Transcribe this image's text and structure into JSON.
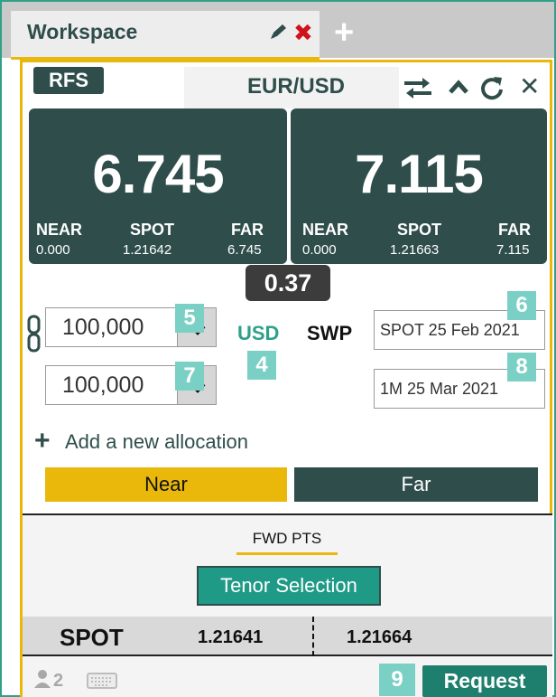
{
  "workspace": {
    "title": "Workspace",
    "add_tab_label": "+"
  },
  "ticket": {
    "product": "RFS",
    "pair": "EUR/USD",
    "icons": [
      "swap-icon",
      "collapse-up-icon",
      "refresh-icon",
      "close-icon"
    ]
  },
  "tiles": {
    "near": {
      "rate": "6.745",
      "labels": {
        "near": "NEAR",
        "spot": "SPOT",
        "far": "FAR"
      },
      "values": {
        "near": "0.000",
        "spot": "1.21642",
        "far": "6.745"
      }
    },
    "far": {
      "rate": "7.115",
      "labels": {
        "near": "NEAR",
        "spot": "SPOT",
        "far": "FAR"
      },
      "values": {
        "near": "0.000",
        "spot": "1.21663",
        "far": "7.115"
      }
    }
  },
  "spread": "0.37",
  "amounts": {
    "near": "100,000",
    "far": "100,000"
  },
  "currency": "USD",
  "side": "SWP",
  "dates": {
    "near": "SPOT 25 Feb 2021",
    "far": "1M 25 Mar 2021"
  },
  "badges": {
    "b4": "4",
    "b5": "5",
    "b6": "6",
    "b7": "7",
    "b8": "8",
    "b9": "9"
  },
  "add_allocation": "Add a new allocation",
  "legs": {
    "near": "Near",
    "far": "Far"
  },
  "fwd_pts": "FWD PTS",
  "tenor_selection": "Tenor Selection",
  "spot_row": {
    "label": "SPOT",
    "bid": "1.21641",
    "ask": "1.21664"
  },
  "footer": {
    "user_count": "2",
    "request": "Request"
  },
  "colors": {
    "teal_dark": "#2f4e4b",
    "accent_yellow": "#e9b80b",
    "accent_teal": "#2fa08a",
    "badge": "#7bd0c5",
    "close_red": "#d0121b"
  }
}
